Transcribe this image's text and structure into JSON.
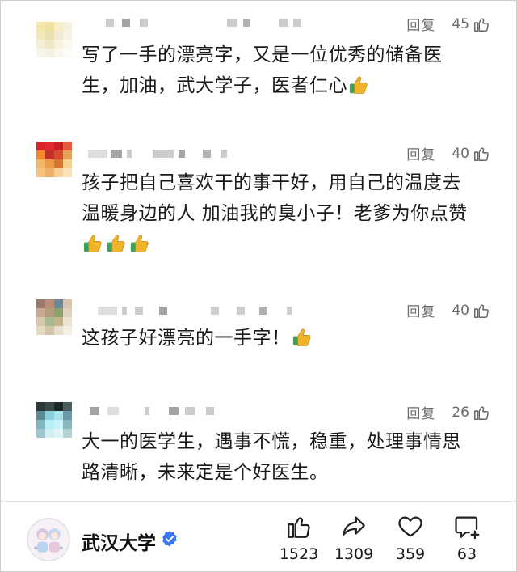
{
  "comments": [
    {
      "reply_label": "回复",
      "likes": "45",
      "line1": "写了一手的漂亮字，又是一位优秀的储备医",
      "line2": "生，加油，武大学子，医者仁心",
      "emoji_count": 1
    },
    {
      "reply_label": "回复",
      "likes": "40",
      "line1": "孩子把自己喜欢干的事干好，用自己的温度去",
      "line2": "温暖身边的人 加油我的臭小子！老爹为你点赞",
      "emoji_count": 3
    },
    {
      "reply_label": "回复",
      "likes": "40",
      "line1": "这孩子好漂亮的一手字！",
      "emoji_count": 1
    },
    {
      "reply_label": "回复",
      "likes": "26",
      "line1": "大一的医学生，遇事不慌，稳重，处理事情思",
      "line2": "路清晰，未来定是个好医生。",
      "emoji_count": 0
    }
  ],
  "account": {
    "name": "武汉大学",
    "verified_icon": "verified-check-icon",
    "verified_color": "#3a78f2"
  },
  "stats": {
    "likes": "1523",
    "shares": "1309",
    "favorites": "359",
    "comments": "63"
  },
  "colors": {
    "emoji_thumb": "#f0b429",
    "emoji_cuff": "#3aa35a",
    "secondary_text": "#6b6b6b"
  }
}
